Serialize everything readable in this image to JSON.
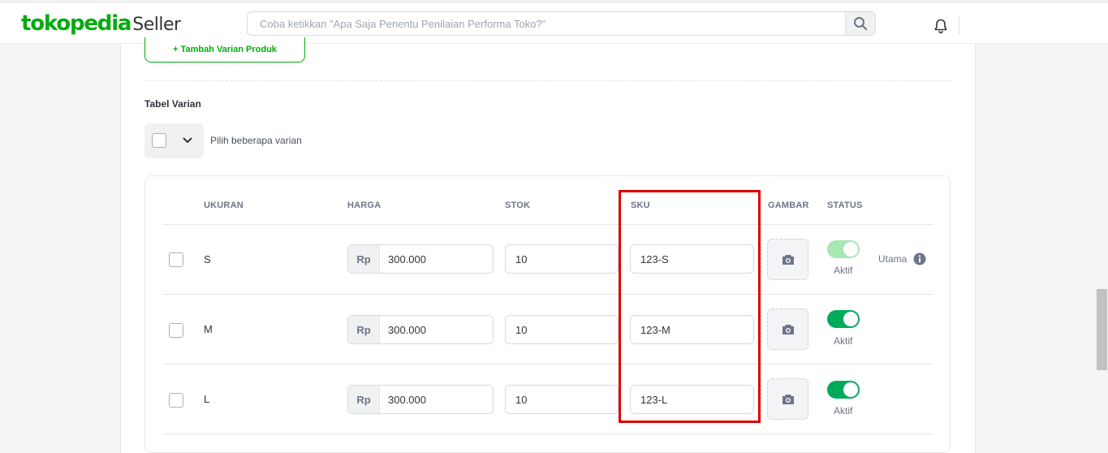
{
  "header": {
    "logo_main": "tokopedia",
    "logo_sub": "Seller",
    "search_placeholder": "Coba ketikkan \"Apa Saja Penentu Penilaian Performa Toko?\""
  },
  "form": {
    "add_variant_label": "+ Tambah Varian Produk",
    "table_title": "Tabel Varian",
    "bulk_select_label": "Pilih beberapa varian"
  },
  "table": {
    "columns": [
      "UKURAN",
      "HARGA",
      "STOK",
      "SKU",
      "GAMBAR",
      "STATUS"
    ],
    "rows": [
      {
        "size": "S",
        "currency": "Rp",
        "price": "300.000",
        "stock": "10",
        "sku": "123-S",
        "status": "Aktif",
        "toggle_on": true,
        "primary_label": "Utama"
      },
      {
        "size": "M",
        "currency": "Rp",
        "price": "300.000",
        "stock": "10",
        "sku": "123-M",
        "status": "Aktif",
        "toggle_on": true
      },
      {
        "size": "L",
        "currency": "Rp",
        "price": "300.000",
        "stock": "10",
        "sku": "123-L",
        "status": "Aktif",
        "toggle_on": true
      }
    ]
  },
  "colors": {
    "brand": "#03ac0e",
    "toggle_on": "#00aa5b",
    "highlight": "#e00000"
  },
  "icons": [
    "search-icon",
    "bell-icon",
    "chevron-down-icon",
    "camera-icon",
    "info-icon"
  ]
}
